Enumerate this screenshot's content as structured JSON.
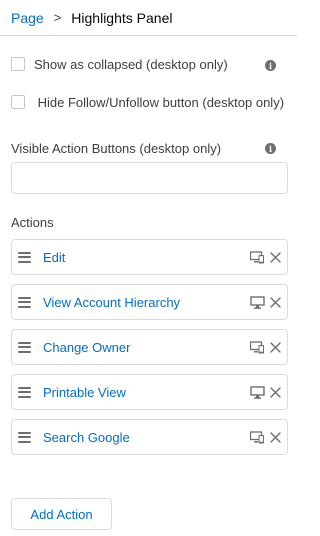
{
  "breadcrumb": {
    "parent": "Page",
    "separator": ">",
    "current": "Highlights Panel"
  },
  "options": {
    "show_collapsed": {
      "label": "Show as collapsed (desktop only)",
      "checked": false
    },
    "hide_follow": {
      "label": "Hide Follow/Unfollow button (desktop only)",
      "checked": false
    }
  },
  "visible_buttons": {
    "label": "Visible Action Buttons (desktop only)",
    "value": "",
    "placeholder": ""
  },
  "actions_section": {
    "title": "Actions",
    "items": [
      {
        "label": "Edit",
        "device_icon": "desktop-and-mobile-icon"
      },
      {
        "label": "View Account Hierarchy",
        "device_icon": "desktop-icon"
      },
      {
        "label": "Change Owner",
        "device_icon": "desktop-and-mobile-icon"
      },
      {
        "label": "Printable View",
        "device_icon": "desktop-icon"
      },
      {
        "label": "Search Google",
        "device_icon": "desktop-and-mobile-icon"
      }
    ],
    "add_label": "Add Action"
  },
  "colors": {
    "link": "#006dcc",
    "border": "#dddbda",
    "icon": "#706e6b",
    "text": "#3e3e3c"
  }
}
